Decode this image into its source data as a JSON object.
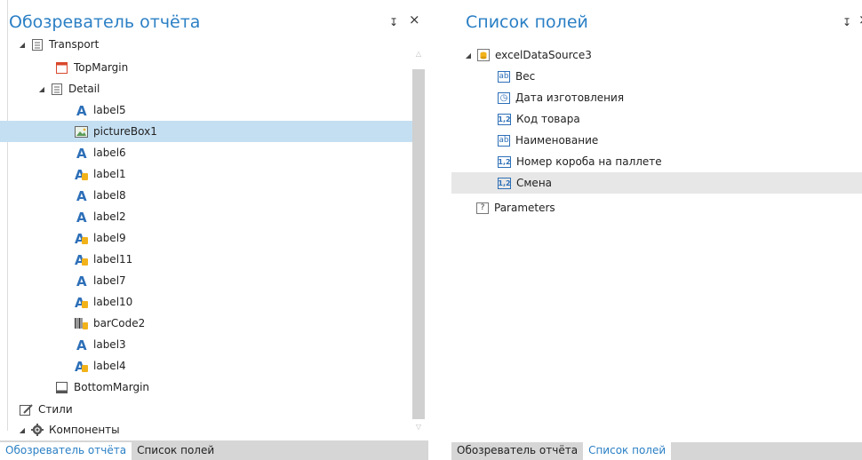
{
  "left_panel": {
    "title": "Обозреватель отчёта",
    "pin_glyph": "↧",
    "close_glyph": "×",
    "items": [
      {
        "label": "Transport",
        "icon": "band-icon"
      },
      {
        "label": "TopMargin",
        "icon": "margin-icon"
      },
      {
        "label": "Detail",
        "icon": "band-icon"
      },
      {
        "label": "label5",
        "icon": "label-icon"
      },
      {
        "label": "pictureBox1",
        "icon": "picture-icon"
      },
      {
        "label": "label6",
        "icon": "label-icon"
      },
      {
        "label": "label1",
        "icon": "bound-label-icon"
      },
      {
        "label": "label8",
        "icon": "label-icon"
      },
      {
        "label": "label2",
        "icon": "label-icon"
      },
      {
        "label": "label9",
        "icon": "bound-label-icon"
      },
      {
        "label": "label11",
        "icon": "bound-label-icon"
      },
      {
        "label": "label7",
        "icon": "label-icon"
      },
      {
        "label": "label10",
        "icon": "bound-label-icon"
      },
      {
        "label": "barCode2",
        "icon": "barcode-icon"
      },
      {
        "label": "label3",
        "icon": "label-icon"
      },
      {
        "label": "label4",
        "icon": "bound-label-icon"
      },
      {
        "label": "BottomMargin",
        "icon": "bottom-margin-icon"
      },
      {
        "label": "Стили",
        "icon": "styles-icon"
      },
      {
        "label": "Компоненты",
        "icon": "components-icon"
      }
    ],
    "tabs": [
      "Обозреватель отчёта",
      "Список полей"
    ],
    "scroll_up_glyph": "△",
    "scroll_down_glyph": "▽"
  },
  "right_panel": {
    "title": "Список полей",
    "pin_glyph": "↧",
    "close_glyph": "×",
    "items": [
      {
        "label": "excelDataSource3",
        "icon": "datasource-icon"
      },
      {
        "label": "Вес",
        "icon": "string-field-icon",
        "icon_text": "ab"
      },
      {
        "label": "Дата изготовления",
        "icon": "datetime-field-icon",
        "icon_text": "◷"
      },
      {
        "label": "Код товара",
        "icon": "number-field-icon",
        "icon_text": "1,2"
      },
      {
        "label": "Наименование",
        "icon": "string-field-icon",
        "icon_text": "ab"
      },
      {
        "label": "Номер короба на паллете",
        "icon": "number-field-icon",
        "icon_text": "1,2"
      },
      {
        "label": "Смена",
        "icon": "number-field-icon",
        "icon_text": "1,2"
      },
      {
        "label": "Parameters",
        "icon": "parameters-icon",
        "icon_text": "?"
      }
    ],
    "tabs": [
      "Обозреватель отчёта",
      "Список полей"
    ]
  },
  "colors": {
    "title_blue": "#2a7fc5",
    "selected_row": "#c5dff2",
    "hover_row": "#e7e7e7",
    "label_icon_blue": "#2d6fb8",
    "bound_icon_yellow": "#f2b21a",
    "margin_red": "#d9472b"
  }
}
